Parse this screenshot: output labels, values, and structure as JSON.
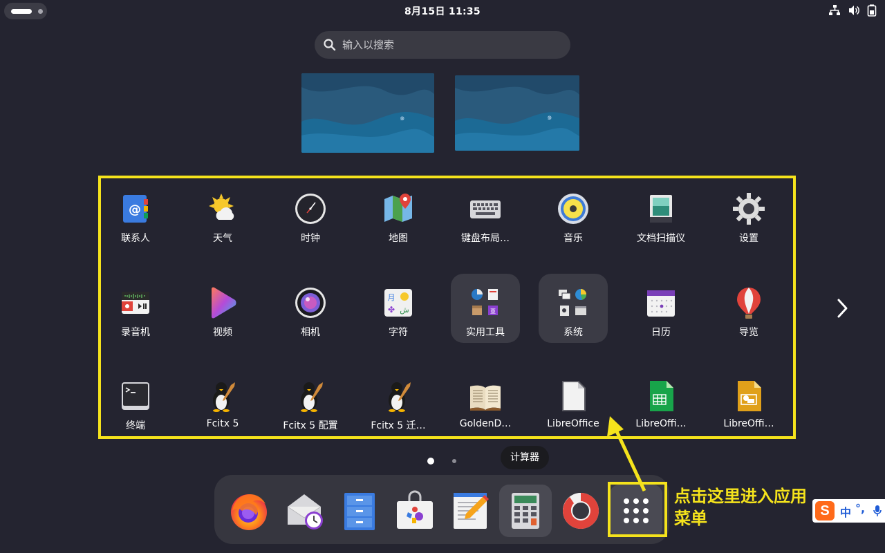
{
  "topbar": {
    "clock": "8月15日  11:35",
    "tray_icons": [
      "network-icon",
      "volume-icon",
      "battery-icon"
    ]
  },
  "search": {
    "placeholder": "输入以搜索"
  },
  "app_grid": {
    "rows": [
      [
        {
          "label": "联系人",
          "icon": "contacts-icon"
        },
        {
          "label": "天气",
          "icon": "weather-icon"
        },
        {
          "label": "时钟",
          "icon": "clock-icon"
        },
        {
          "label": "地图",
          "icon": "maps-icon"
        },
        {
          "label": "键盘布局…",
          "icon": "keyboard-icon"
        },
        {
          "label": "音乐",
          "icon": "music-icon"
        },
        {
          "label": "文档扫描仪",
          "icon": "scanner-icon"
        },
        {
          "label": "设置",
          "icon": "settings-gear-icon"
        }
      ],
      [
        {
          "label": "录音机",
          "icon": "sound-recorder-icon"
        },
        {
          "label": "视频",
          "icon": "videos-icon"
        },
        {
          "label": "相机",
          "icon": "camera-icon"
        },
        {
          "label": "字符",
          "icon": "characters-icon"
        },
        {
          "label": "实用工具",
          "icon": "utilities-folder-icon",
          "folder": true
        },
        {
          "label": "系统",
          "icon": "system-folder-icon",
          "folder": true
        },
        {
          "label": "日历",
          "icon": "calendar-icon"
        },
        {
          "label": "导览",
          "icon": "tour-balloon-icon"
        }
      ],
      [
        {
          "label": "终端",
          "icon": "terminal-icon"
        },
        {
          "label": "Fcitx 5",
          "icon": "fcitx-penguin-icon"
        },
        {
          "label": "Fcitx 5 配置",
          "icon": "fcitx-penguin-icon"
        },
        {
          "label": "Fcitx 5 迁…",
          "icon": "fcitx-penguin-icon"
        },
        {
          "label": "GoldenD…",
          "icon": "dictionary-book-icon"
        },
        {
          "label": "LibreOffice",
          "icon": "libreoffice-icon"
        },
        {
          "label": "LibreOffi…",
          "icon": "libreoffice-calc-icon"
        },
        {
          "label": "LibreOffi…",
          "icon": "libreoffice-impress-icon"
        }
      ]
    ],
    "page_indicator": {
      "current": 1,
      "total": 2
    }
  },
  "tooltip": "计算器",
  "dock": {
    "items": [
      {
        "name": "firefox",
        "icon": "firefox-icon"
      },
      {
        "name": "evolution",
        "icon": "mail-clock-icon"
      },
      {
        "name": "files",
        "icon": "file-cabinet-icon"
      },
      {
        "name": "software",
        "icon": "software-bag-icon"
      },
      {
        "name": "text-editor",
        "icon": "text-editor-icon"
      },
      {
        "name": "calculator",
        "icon": "calculator-icon"
      },
      {
        "name": "help",
        "icon": "lifebuoy-icon"
      },
      {
        "name": "show-apps",
        "icon": "app-grid-icon"
      }
    ]
  },
  "annotation": {
    "line1": "点击这里进入应用",
    "line2": "菜单"
  },
  "ime": {
    "logo": "S",
    "mode": "中",
    "punct": "°,"
  },
  "colors": {
    "background": "#242430",
    "highlight": "#f5e31c"
  }
}
